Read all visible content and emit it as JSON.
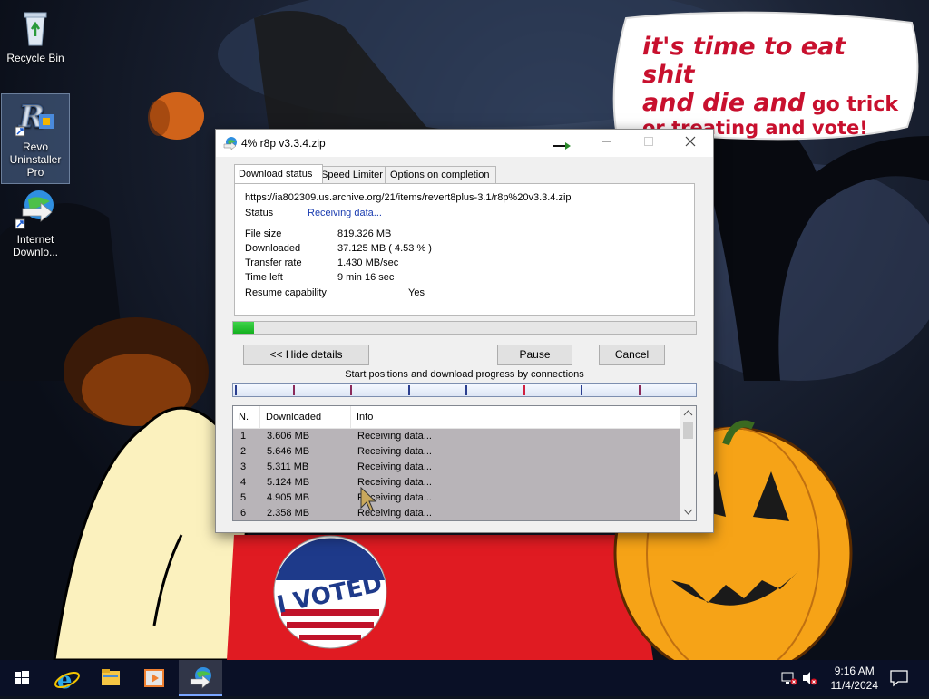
{
  "desktop": {
    "icons": [
      {
        "label": "Recycle Bin",
        "icon": "recycle-bin-icon"
      },
      {
        "label_lines": [
          "Revo",
          "Uninstaller",
          "Pro"
        ],
        "icon": "revo-uninstaller-icon"
      },
      {
        "label_lines": [
          "Internet",
          "Downlo..."
        ],
        "icon": "internet-download-manager-icon"
      }
    ],
    "wallpaper_text": {
      "line1": "it's time to eat shit",
      "line2a": "and die and",
      "line2b": " go trick",
      "line3": "or treating and vote!",
      "sticker": "I VOTED"
    }
  },
  "window": {
    "title": "4% r8p v3.3.4.zip",
    "tabs": [
      "Download status",
      "Speed Limiter",
      "Options on completion"
    ],
    "active_tab": 0,
    "url": "https://ia802309.us.archive.org/21/items/revert8plus-3.1/r8p%20v3.3.4.zip",
    "status_label": "Status",
    "status_value": "Receiving data...",
    "fields": [
      {
        "label": "File size",
        "value": "819.326  MB"
      },
      {
        "label": "Downloaded",
        "value": "37.125  MB  ( 4.53 % )"
      },
      {
        "label": "Transfer rate",
        "value": "1.430  MB/sec"
      },
      {
        "label": "Time left",
        "value": "9 min 16 sec"
      },
      {
        "label": "Resume capability",
        "value": "Yes"
      }
    ],
    "progress_fraction": 0.0453,
    "buttons": {
      "hide_details": "<< Hide details",
      "pause": "Pause",
      "cancel": "Cancel"
    },
    "connections_caption": "Start positions and download progress by connections",
    "table": {
      "columns": [
        "N.",
        "Downloaded",
        "Info"
      ],
      "rows": [
        [
          "1",
          "3.606  MB",
          "Receiving data..."
        ],
        [
          "2",
          "5.646  MB",
          "Receiving data..."
        ],
        [
          "3",
          "5.311  MB",
          "Receiving data..."
        ],
        [
          "4",
          "5.124  MB",
          "Receiving data..."
        ],
        [
          "5",
          "4.905  MB",
          "Receiving data..."
        ],
        [
          "6",
          "2.358  MB",
          "Receiving data..."
        ]
      ]
    },
    "connection_markers": [
      {
        "pos": 0.0,
        "color": "#2a3e8f"
      },
      {
        "pos": 0.125,
        "color": "#8a2a5a"
      },
      {
        "pos": 0.25,
        "color": "#8a2a5a"
      },
      {
        "pos": 0.375,
        "color": "#2a3e8f"
      },
      {
        "pos": 0.5,
        "color": "#2a3e8f"
      },
      {
        "pos": 0.625,
        "color": "#d02040"
      },
      {
        "pos": 0.75,
        "color": "#2a3e8f"
      },
      {
        "pos": 0.875,
        "color": "#8a2a5a"
      }
    ]
  },
  "taskbar": {
    "apps": [
      "start-icon",
      "internet-explorer-icon",
      "file-explorer-icon",
      "media-player-icon",
      "internet-download-manager-icon"
    ],
    "active_app": 4,
    "time": "9:16 AM",
    "date": "11/4/2024"
  }
}
